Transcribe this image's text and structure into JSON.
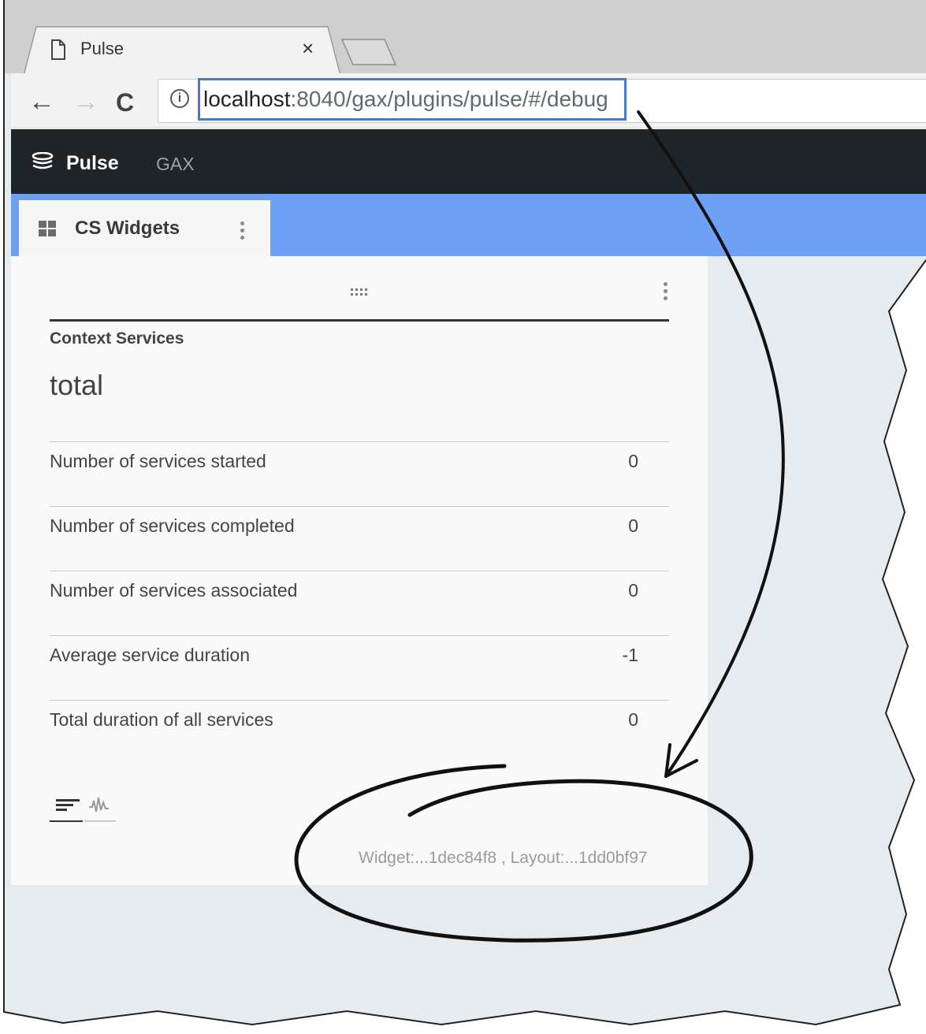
{
  "browser": {
    "tab_title": "Pulse",
    "tab_close": "×",
    "url_host": "localhost",
    "url_rest": ":8040/gax/plugins/pulse/#/debug",
    "info_glyph": "i",
    "back_glyph": "←",
    "forward_glyph": "→",
    "reload_glyph": "C"
  },
  "appbar": {
    "brand": "Pulse",
    "nav_item": "GAX"
  },
  "tabs": {
    "active_label": "CS Widgets"
  },
  "widget": {
    "section_title": "Context Services",
    "statistic": "total",
    "metrics": [
      {
        "label": "Number of services started",
        "value": "0"
      },
      {
        "label": "Number of services completed",
        "value": "0"
      },
      {
        "label": "Number of services associated",
        "value": "0"
      },
      {
        "label": "Average service duration",
        "value": "-1"
      },
      {
        "label": "Total duration of all services",
        "value": "0"
      }
    ],
    "footer_id": "Widget:...1dec84f8 , Layout:...1dd0bf97"
  },
  "colors": {
    "appbar": "#1f2428",
    "tab_accent": "#6ea1f5",
    "url_highlight": "#4a78c5",
    "dashboard_bg": "#e6ebf0"
  },
  "icons": [
    "page-icon",
    "close-icon",
    "back-arrow-icon",
    "forward-arrow-icon",
    "reload-icon",
    "info-icon",
    "pulse-logo-icon",
    "grid-icon",
    "more-vert-icon",
    "drag-handle-icon",
    "list-view-icon",
    "waveform-icon"
  ]
}
